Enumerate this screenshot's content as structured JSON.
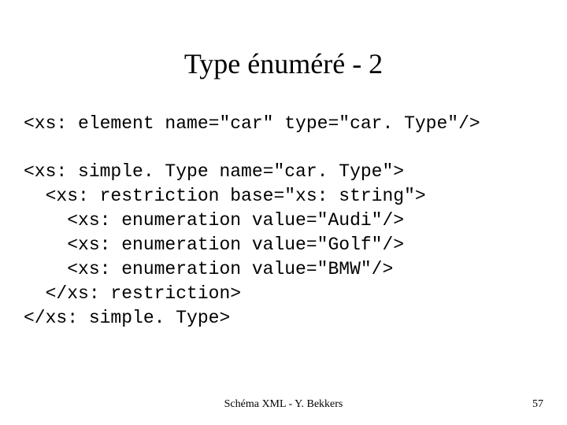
{
  "title": "Type énuméré - 2",
  "code": {
    "line1": "<xs: element name=\"car\" type=\"car. Type\"/>",
    "line2": "<xs: simple. Type name=\"car. Type\">",
    "line3": "  <xs: restriction base=\"xs: string\">",
    "line4": "    <xs: enumeration value=\"Audi\"/>",
    "line5": "    <xs: enumeration value=\"Golf\"/>",
    "line6": "    <xs: enumeration value=\"BMW\"/>",
    "line7": "  </xs: restriction>",
    "line8": "</xs: simple. Type>"
  },
  "footer": "Schéma XML - Y. Bekkers",
  "page_number": "57"
}
